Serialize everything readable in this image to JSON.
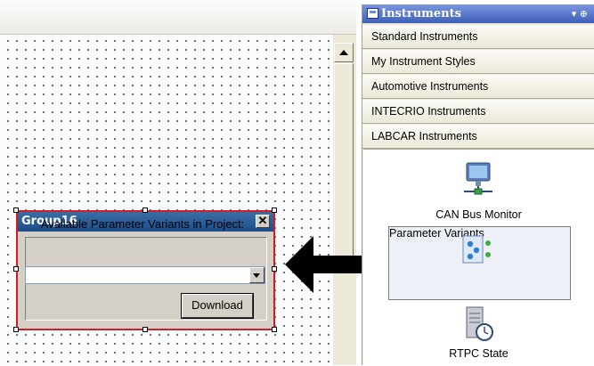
{
  "designer": {
    "group": {
      "title": "Group16",
      "close_glyph": "✕",
      "label": "Available Parameter Variants in Project:",
      "select_value": "",
      "download_label": "Download"
    }
  },
  "instruments_panel": {
    "title": "Instruments",
    "controls": "▾ ⊕",
    "categories": [
      "Standard Instruments",
      "My Instrument Styles",
      "Automotive Instruments",
      "INTECRIO Instruments",
      "LABCAR Instruments"
    ],
    "items": [
      {
        "label": "CAN Bus Monitor",
        "icon": "monitor-network-icon"
      },
      {
        "label": "Parameter Variants",
        "icon": "parameter-variants-icon",
        "selected": true
      },
      {
        "label": "RTPC State",
        "icon": "server-clock-icon"
      }
    ]
  },
  "colors": {
    "selection_border": "#d41c24",
    "title_bar": "#1c4d8a",
    "panel_header": "#3d5fb7"
  }
}
